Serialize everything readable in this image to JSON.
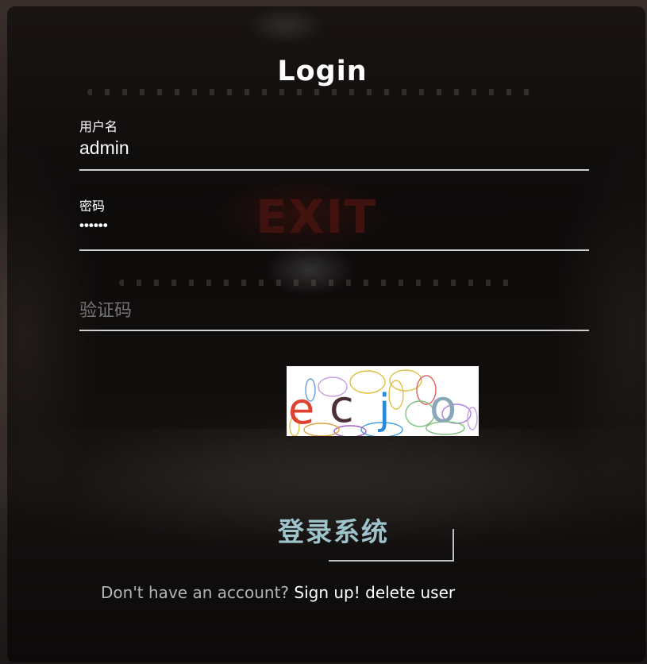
{
  "form": {
    "title": "Login",
    "username_label": "用户名",
    "username_value": "admin",
    "password_label": "密码",
    "password_value": "••••••",
    "captcha_placeholder": "验证码",
    "captcha_image_text": "ecjo",
    "submit_label": "登录系统"
  },
  "footer": {
    "prompt": "Don't have an account?",
    "signup_link": "Sign up!",
    "delete_link": "delete user"
  },
  "colors": {
    "submit_text": "#9ec3cb",
    "card_overlay": "rgba(0,0,0,0.55)"
  }
}
